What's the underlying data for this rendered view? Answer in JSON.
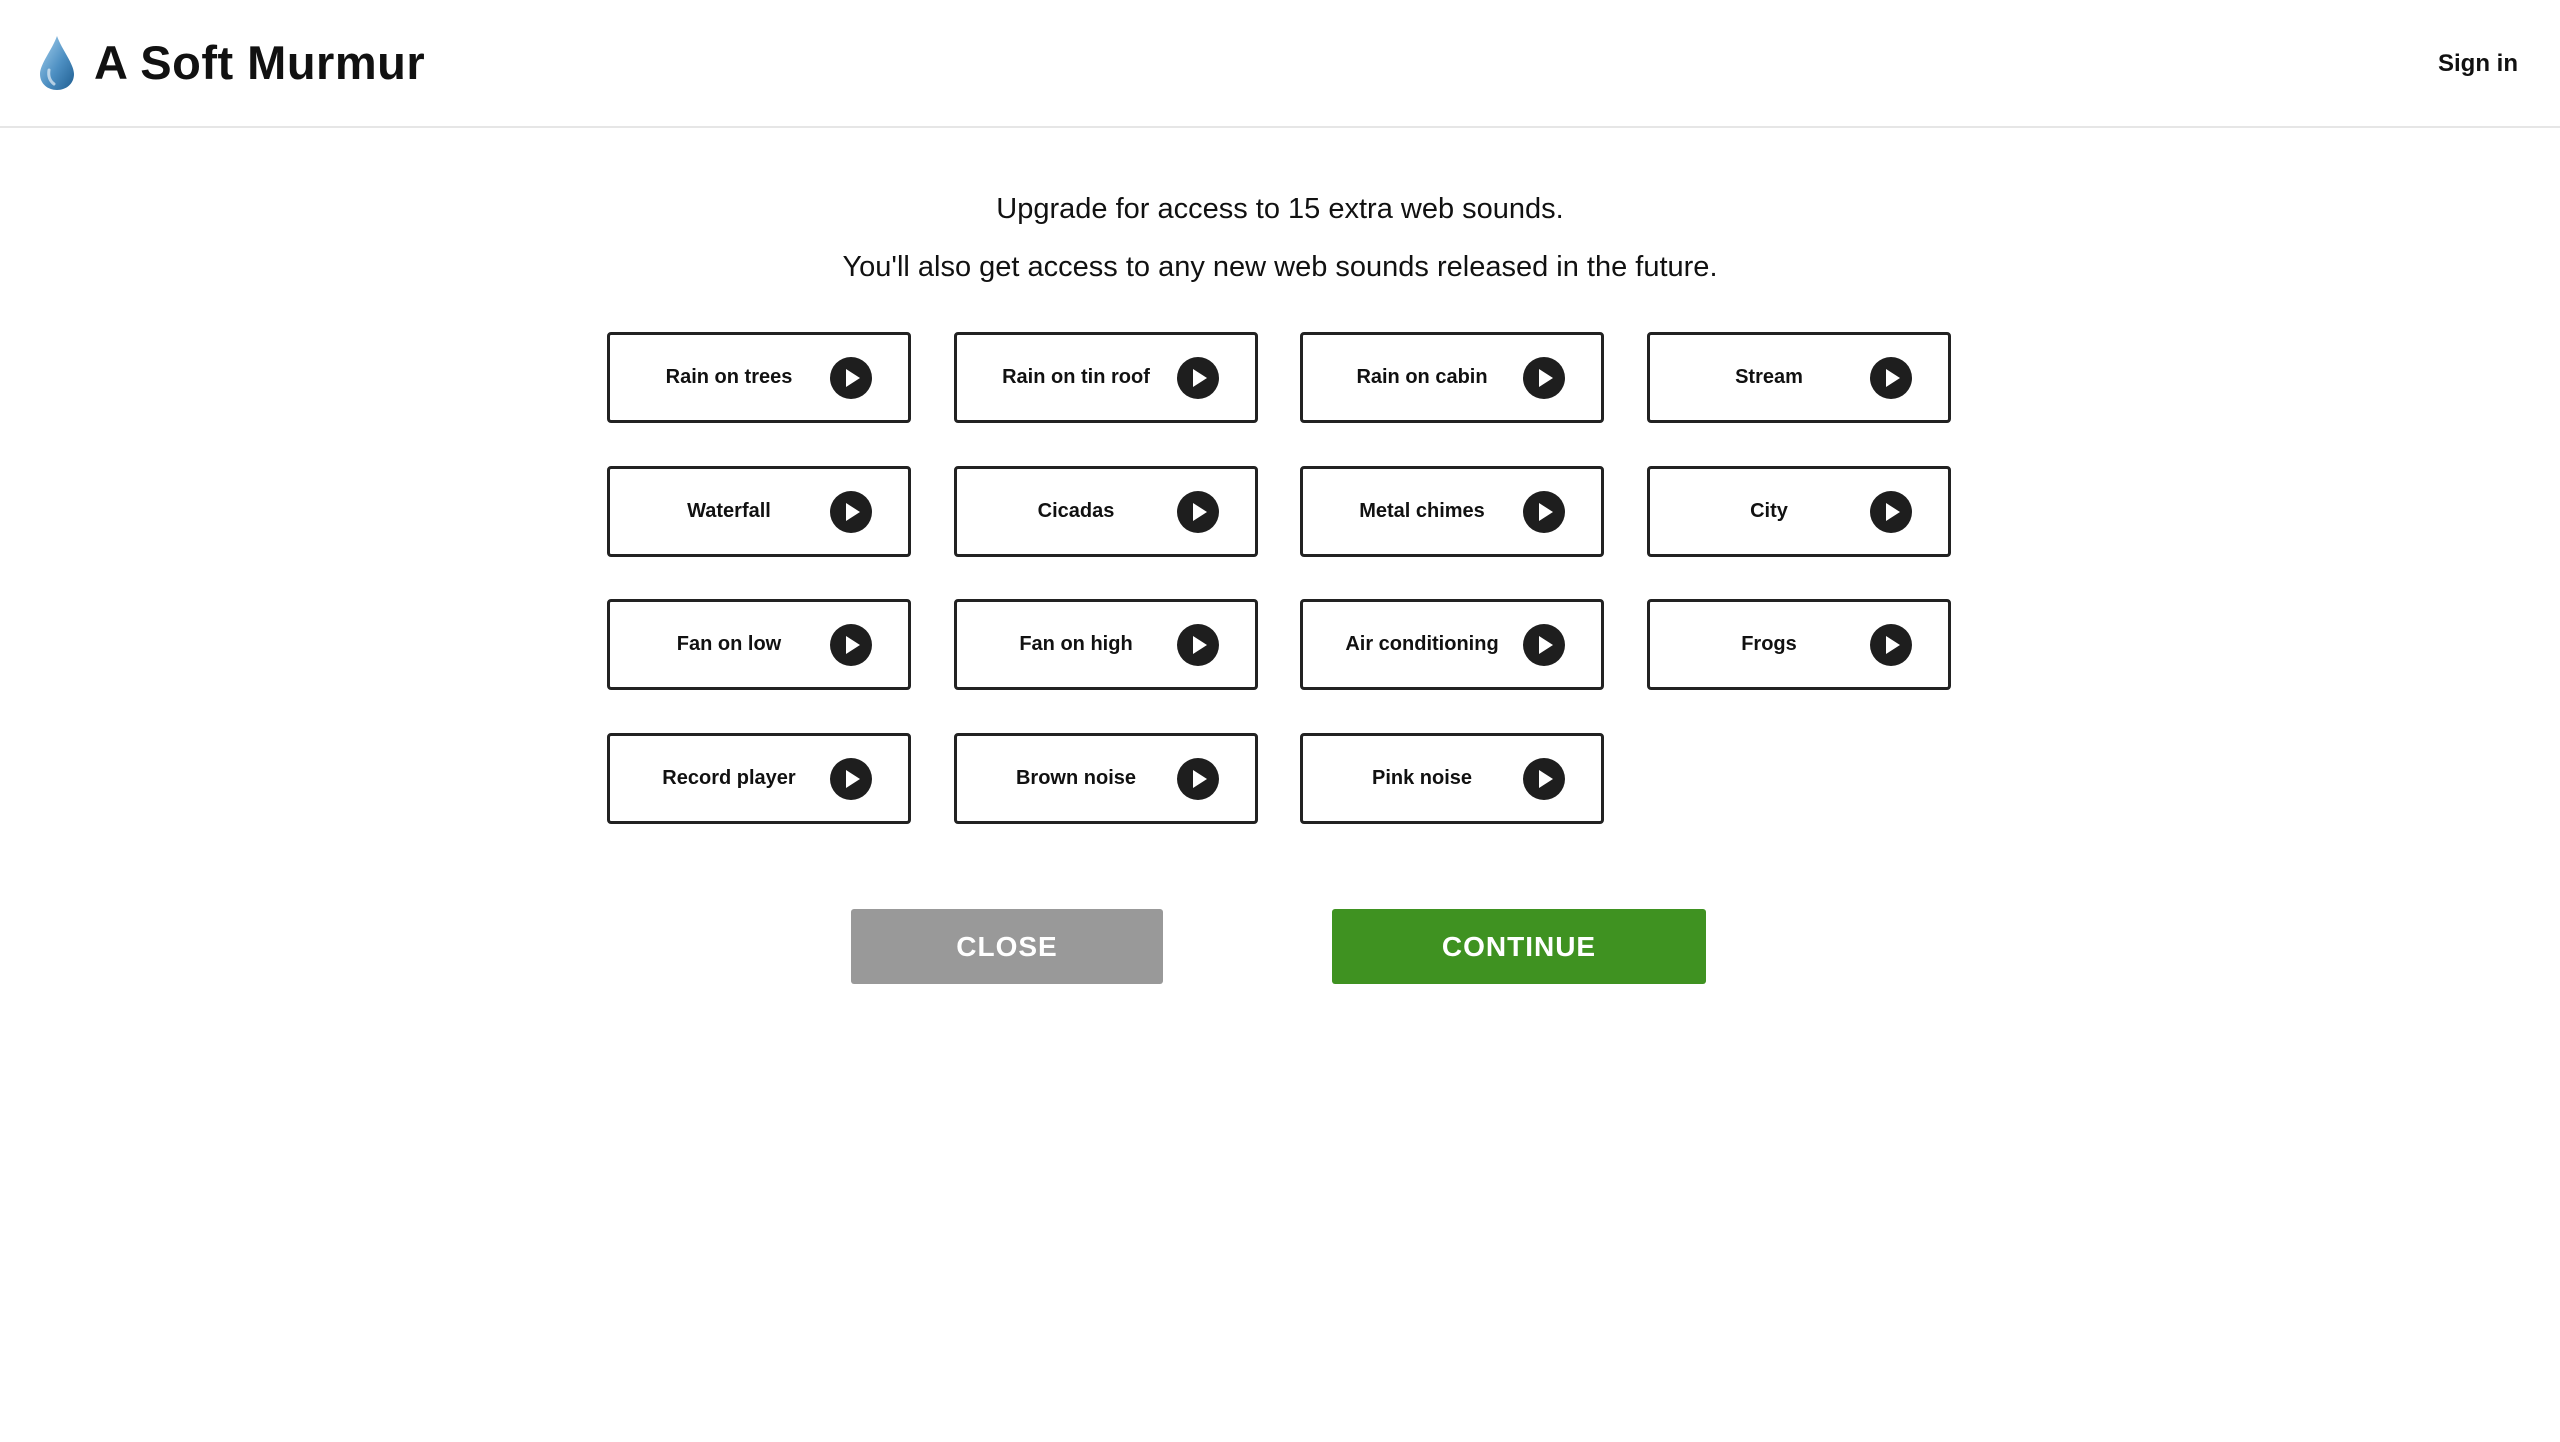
{
  "header": {
    "app_title": "A Soft Murmur",
    "logo_icon": "water-drop-icon",
    "sign_in_label": "Sign in"
  },
  "upgrade": {
    "headline": "Upgrade for access to 15 extra web sounds.",
    "subheadline": "You'll also get access to any new web sounds released in the future."
  },
  "sounds": [
    {
      "label": "Rain on trees"
    },
    {
      "label": "Rain on tin roof"
    },
    {
      "label": "Rain on cabin"
    },
    {
      "label": "Stream"
    },
    {
      "label": "Waterfall"
    },
    {
      "label": "Cicadas"
    },
    {
      "label": "Metal chimes"
    },
    {
      "label": "City"
    },
    {
      "label": "Fan on low"
    },
    {
      "label": "Fan on high"
    },
    {
      "label": "Air conditioning"
    },
    {
      "label": "Frogs"
    },
    {
      "label": "Record player"
    },
    {
      "label": "Brown noise"
    },
    {
      "label": "Pink noise"
    }
  ],
  "actions": {
    "close_label": "CLOSE",
    "continue_label": "CONTINUE"
  },
  "colors": {
    "continue_green": "#3f9221",
    "close_gray": "#999999",
    "play_button": "#1e1e1e"
  }
}
